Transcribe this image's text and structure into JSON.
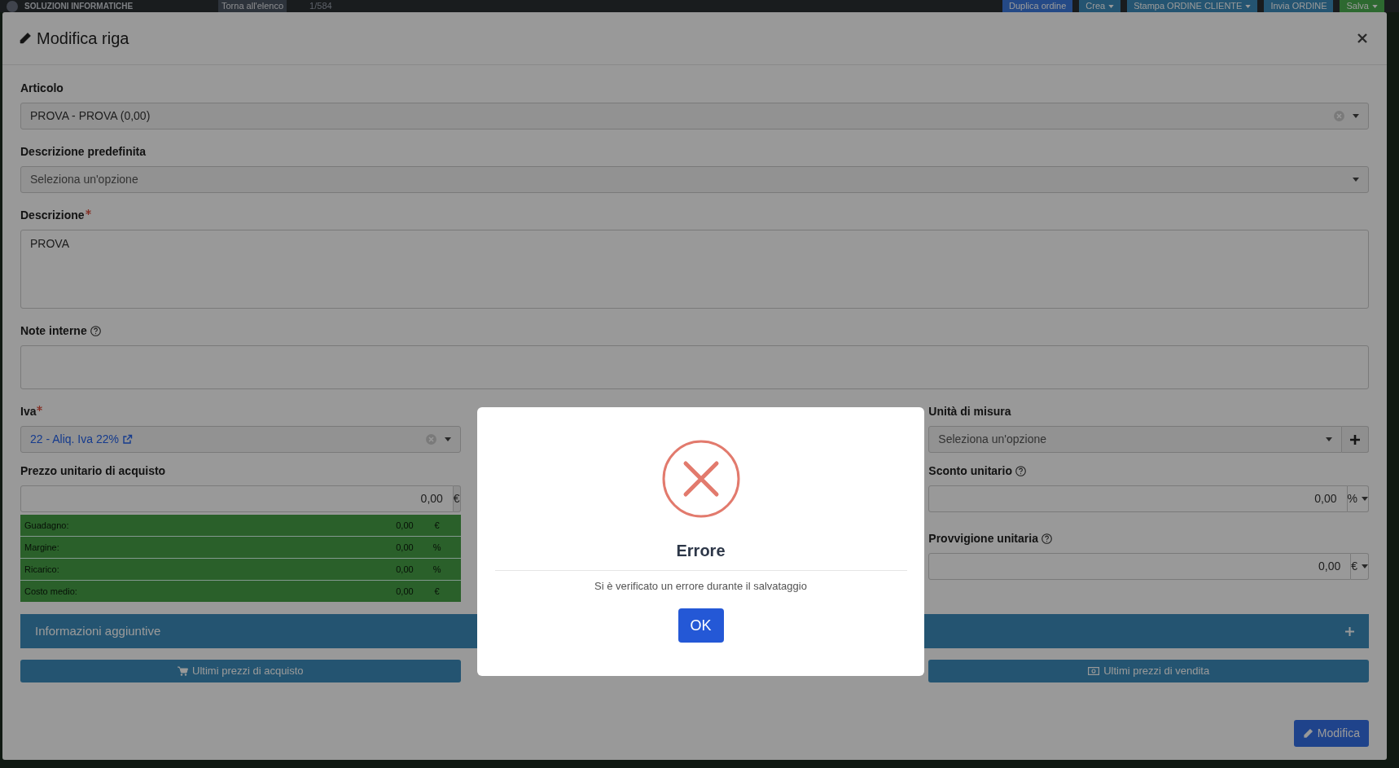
{
  "background": {
    "brand": "SOLUZIONI INFORMATICHE",
    "back_link": "Torna all'elenco",
    "counter": "1/584",
    "actions": [
      {
        "label": "Duplica ordine",
        "kind": "primary",
        "dropdown": false
      },
      {
        "label": "Crea",
        "kind": "info",
        "dropdown": true
      },
      {
        "label": "Stampa ORDINE CLIENTE",
        "kind": "info",
        "dropdown": true
      },
      {
        "label": "Invia ORDINE",
        "kind": "info",
        "dropdown": false
      },
      {
        "label": "Salva",
        "kind": "success",
        "dropdown": true
      }
    ]
  },
  "modal": {
    "title": "Modifica riga",
    "articolo": {
      "label": "Articolo",
      "value": "PROVA - PROVA (0,00)",
      "clearable": true
    },
    "descrizione_predefinita": {
      "label": "Descrizione predefinita",
      "placeholder": "Seleziona un'opzione"
    },
    "descrizione": {
      "label": "Descrizione",
      "required": true,
      "value": "PROVA"
    },
    "note_interne": {
      "label": "Note interne",
      "help": true
    },
    "iva": {
      "label": "Iva",
      "required": true,
      "value": "22 - Aliq. Iva 22%",
      "clearable": true
    },
    "unita_misura": {
      "label": "Unità di misura",
      "placeholder": "Seleziona un'opzione"
    },
    "prezzo_acquisto": {
      "label": "Prezzo unitario di acquisto",
      "value": "0,00",
      "unit": "€"
    },
    "margins": [
      {
        "label": "Guadagno:",
        "value": "0,00",
        "unit": "€"
      },
      {
        "label": "Margine:",
        "value": "0,00",
        "unit": "%"
      },
      {
        "label": "Ricarico:",
        "value": "0,00",
        "unit": "%"
      },
      {
        "label": "Costo medio:",
        "value": "0,00",
        "unit": "€"
      }
    ],
    "sconto": {
      "label": "Sconto unitario",
      "help": true,
      "value": "0,00",
      "unit": "%"
    },
    "provvigione": {
      "label": "Provvigione unitaria",
      "help": true,
      "value": "0,00",
      "unit": "€"
    },
    "info_panel": {
      "title": "Informazioni aggiuntive",
      "expanded": false
    },
    "purchase_prices_button": "Ultimi prezzi di acquisto",
    "sale_prices_button": "Ultimi prezzi di vendita",
    "submit": "Modifica"
  },
  "alert": {
    "kind": "error",
    "title": "Errore",
    "message": "Si è verificato un errore durante il salvataggio",
    "confirm": "OK"
  }
}
